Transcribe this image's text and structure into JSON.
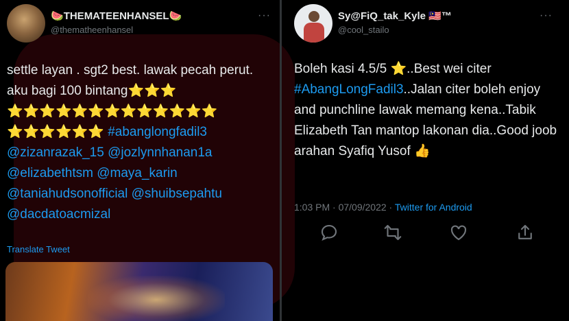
{
  "left_tweet": {
    "name": "THEMATEENHANSEL",
    "name_emoji": "🍉",
    "handle": "@thematheenhansel",
    "more": "···",
    "text_parts": [
      {
        "t": "settle layan . sgt2 best. lawak pecah perut. aku bagi 100 bintang",
        "link": false
      }
    ],
    "stars_line1": "⭐⭐⭐",
    "stars_line2": "⭐⭐⭐⭐⭐⭐⭐⭐⭐⭐⭐⭐⭐",
    "stars_line3": "⭐⭐⭐⭐⭐⭐",
    "hashtag": "#abanglongfadil3",
    "mentions": [
      "@zizanrazak_15",
      "@jozlynnhanan1a",
      "@elizabethtsm",
      "@maya_karin",
      "@taniahudsonofficial",
      "@shuibsepahtu",
      "@dacdatoacmizal"
    ],
    "translate": "Translate Tweet"
  },
  "right_tweet": {
    "name": "Sy@FiQ_tak_Kyle",
    "name_suffix": "🇲🇾™",
    "handle": "@cool_stailo",
    "more": "···",
    "text1": "Boleh kasi 4.5/5 ⭐..Best wei citer",
    "hashtag": "#AbangLongFadil3",
    "text2": "..Jalan citer boleh enjoy and punchline lawak memang kena..Tabik Elizabeth Tan mantop lakonan dia..Good joob arahan Syafiq Yusof 👍",
    "time": "1:03 PM",
    "sep": " · ",
    "date": "07/09/2022",
    "sep2": " · ",
    "client": "Twitter for Android"
  },
  "icons": [
    "reply-icon",
    "retweet-icon",
    "like-icon",
    "share-icon"
  ],
  "colors": {
    "background": "#000000",
    "text": "#e7e9ea",
    "muted": "#71767b",
    "link": "#1d9bf0"
  }
}
